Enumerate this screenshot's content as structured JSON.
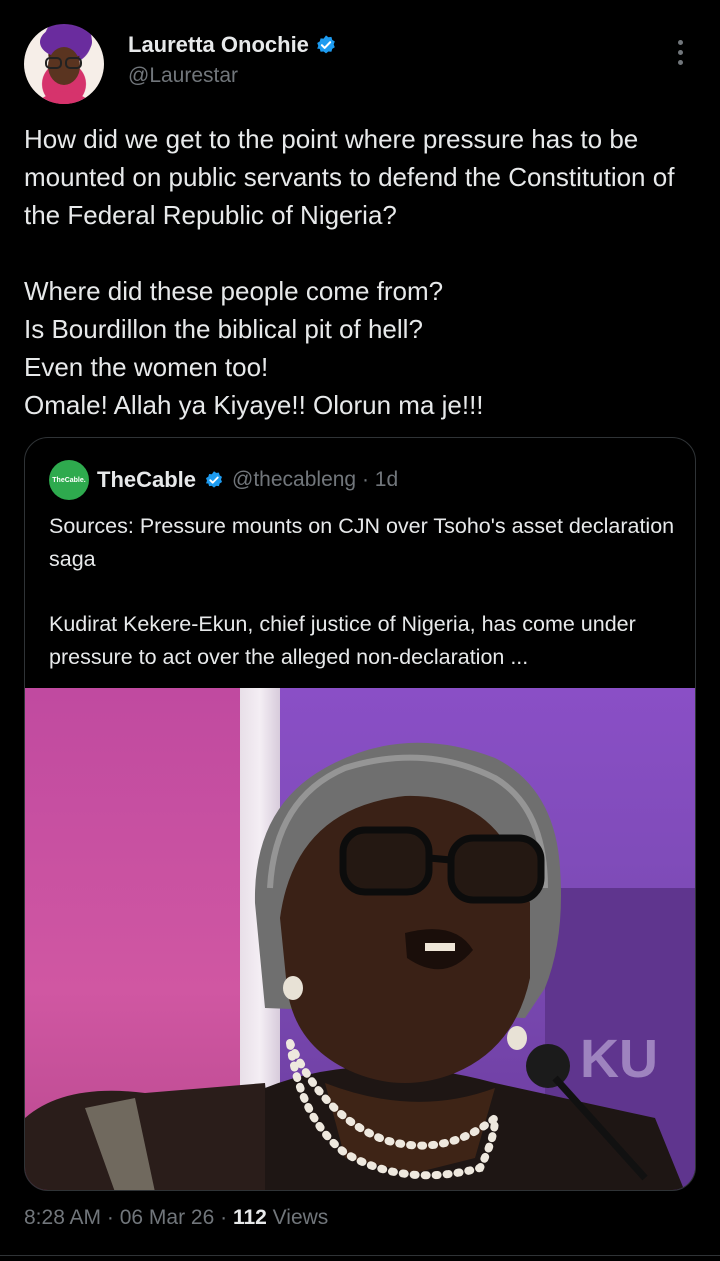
{
  "author": {
    "name": "Lauretta Onochie",
    "handle": "@Laurestar",
    "verified_icon": "verified-badge-icon",
    "accent": "#1d9bf0"
  },
  "tweet": {
    "paragraph1": "How did we get to the point where pressure has to be mounted on public servants to defend the Constitution of the Federal Republic of Nigeria?",
    "line2": "Where did these people come from?",
    "line3": "Is Bourdillon the biblical pit of hell?",
    "line4": "Even the women too!",
    "line5": "Omale! Allah ya Kiyaye!! Olorun ma je!!!"
  },
  "quote": {
    "avatar_text": "TheCable.",
    "name": "TheCable",
    "handle_time": "@thecableng · 1d",
    "headline": "Sources: Pressure mounts on CJN over Tsoho's asset declaration saga",
    "summary": "Kudirat Kekere-Ekun, chief justice of Nigeria, has come under pressure to act over the alleged non-declaration ...",
    "image_backdrop_text": "KU"
  },
  "meta": {
    "time": "8:28 AM · 06 Mar 26 · ",
    "views_count": "112",
    "views_label": " Views"
  }
}
